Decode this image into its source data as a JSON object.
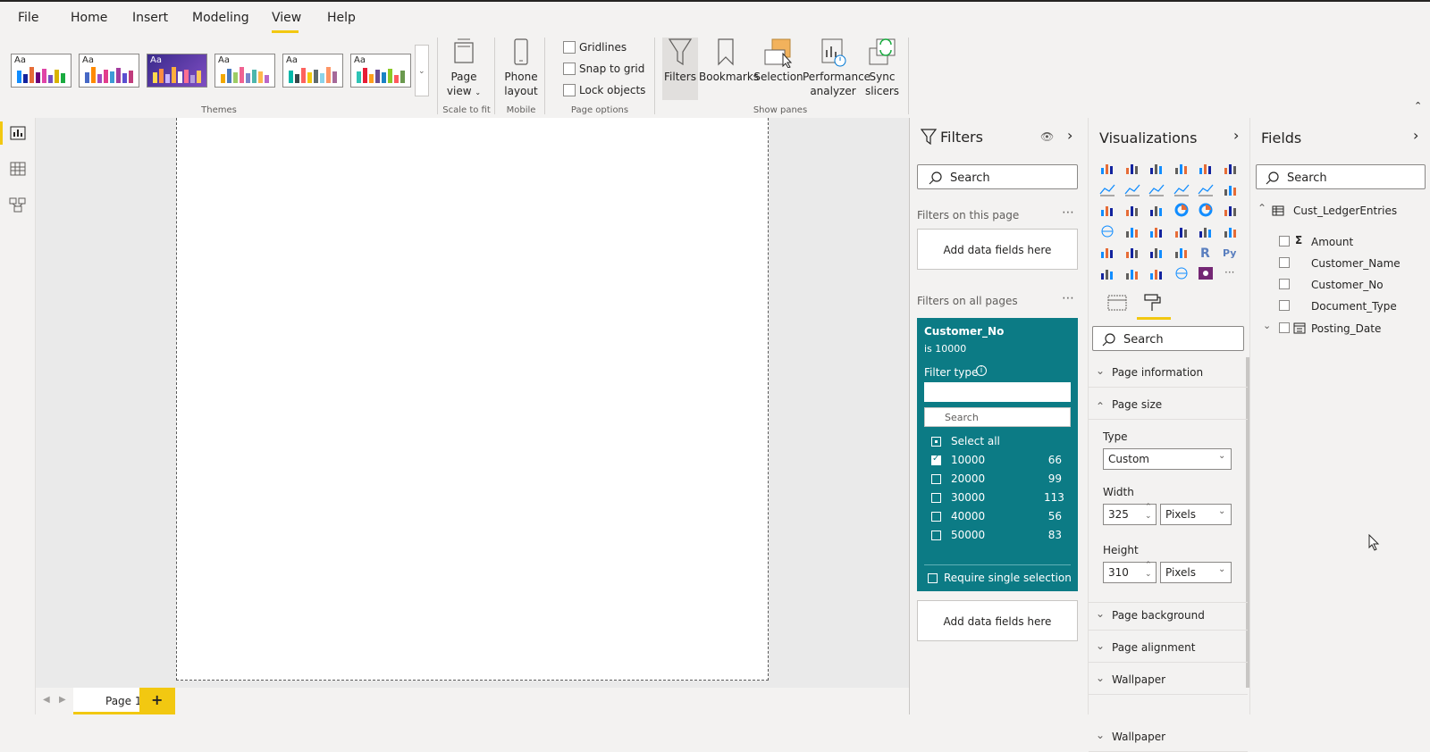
{
  "menu": {
    "items": [
      "File",
      "Home",
      "Insert",
      "Modeling",
      "View",
      "Help"
    ],
    "active": "View"
  },
  "ribbon": {
    "themes_label": "Themes",
    "scale_label": "Scale to fit",
    "mobile_label": "Mobile",
    "page_options_label": "Page options",
    "show_panes_label": "Show panes",
    "page_view": "Page view",
    "phone_layout": "Phone layout",
    "gridlines": "Gridlines",
    "snap_to_grid": "Snap to grid",
    "lock_objects": "Lock objects",
    "filters": "Filters",
    "bookmarks": "Bookmarks",
    "selection": "Selection",
    "performance_analyzer": "Performance analyzer",
    "sync_slicers": "Sync slicers",
    "theme_aa": "Aa"
  },
  "tabs": {
    "page1": "Page 1",
    "add": "+"
  },
  "filters_pane": {
    "title": "Filters",
    "search_placeholder": "Search",
    "on_this_page": "Filters on this page",
    "add_fields": "Add data fields here",
    "on_all_pages": "Filters on all pages",
    "card": {
      "field": "Customer_No",
      "condition": "is 10000",
      "filter_type": "Filter type",
      "search_placeholder": "Search",
      "select_all": "Select all",
      "items": [
        {
          "value": "10000",
          "count": "66",
          "checked": true
        },
        {
          "value": "20000",
          "count": "99",
          "checked": false
        },
        {
          "value": "30000",
          "count": "113",
          "checked": false
        },
        {
          "value": "40000",
          "count": "56",
          "checked": false
        },
        {
          "value": "50000",
          "count": "83",
          "checked": false
        }
      ],
      "require_single": "Require single selection"
    },
    "add_fields_2": "Add data fields here"
  },
  "viz_pane": {
    "title": "Visualizations",
    "search_placeholder": "Search",
    "sections": {
      "page_information": "Page information",
      "page_size": "Page size",
      "page_background": "Page background",
      "page_alignment": "Page alignment",
      "wallpaper": "Wallpaper"
    },
    "type_label": "Type",
    "type_value": "Custom",
    "width_label": "Width",
    "width_value": "325",
    "width_unit": "Pixels",
    "height_label": "Height",
    "height_value": "310",
    "height_unit": "Pixels"
  },
  "fields_pane": {
    "title": "Fields",
    "search_placeholder": "Search",
    "table": "Cust_LedgerEntries",
    "fields": [
      "Amount",
      "Customer_Name",
      "Customer_No",
      "Document_Type",
      "Posting_Date"
    ]
  },
  "colors": {
    "accent_yellow": "#f2c811",
    "filter_card": "#0c7b85"
  }
}
